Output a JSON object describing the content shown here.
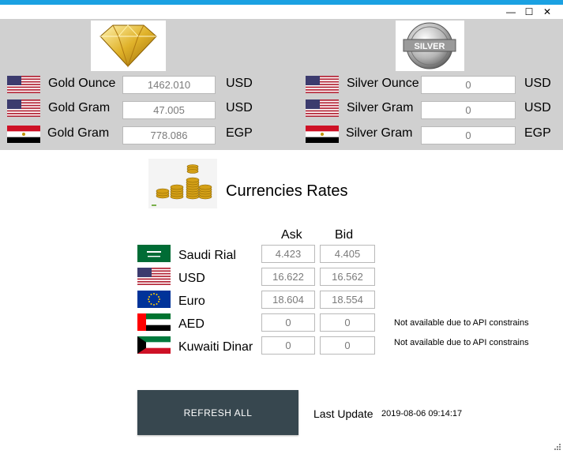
{
  "window": {
    "minimize_glyph": "—",
    "maximize_glyph": "☐",
    "close_glyph": "✕"
  },
  "gold": {
    "logo_icon": "gold-diamond-icon",
    "rows": [
      {
        "label": "Gold Ounce",
        "value": "1462.010",
        "unit": "USD",
        "flag": "usa-flag-icon"
      },
      {
        "label": "Gold Gram",
        "value": "47.005",
        "unit": "USD",
        "flag": "usa-flag-icon"
      },
      {
        "label": "Gold Gram",
        "value": "778.086",
        "unit": "EGP",
        "flag": "egypt-flag-icon"
      }
    ]
  },
  "silver": {
    "logo_text": "SILVER",
    "rows": [
      {
        "label": "Silver Ounce",
        "value": "0",
        "unit": "USD",
        "flag": "usa-flag-icon"
      },
      {
        "label": "Silver Gram",
        "value": "0",
        "unit": "USD",
        "flag": "usa-flag-icon"
      },
      {
        "label": "Silver Gram",
        "value": "0",
        "unit": "EGP",
        "flag": "egypt-flag-icon"
      }
    ]
  },
  "currencies": {
    "title": "Currencies Rates",
    "coins_icon": "gold-coins-icon",
    "ask_header": "Ask",
    "bid_header": "Bid",
    "rows": [
      {
        "name": "Saudi Rial",
        "ask": "4.423",
        "bid": "4.405",
        "note": "",
        "flag": "saudi-flag-icon"
      },
      {
        "name": "USD",
        "ask": "16.622",
        "bid": "16.562",
        "note": "",
        "flag": "usa-flag-icon"
      },
      {
        "name": "Euro",
        "ask": "18.604",
        "bid": "18.554",
        "note": "",
        "flag": "eu-flag-icon"
      },
      {
        "name": "AED",
        "ask": "0",
        "bid": "0",
        "note": "Not available due to API constrains",
        "flag": "uae-flag-icon"
      },
      {
        "name": "Kuwaiti Dinar",
        "ask": "0",
        "bid": "0",
        "note": "Not available due to API constrains",
        "flag": "kuwait-flag-icon"
      }
    ]
  },
  "footer": {
    "refresh_label": "REFRESH ALL",
    "last_update_label": "Last Update",
    "last_update_value": "2019-08-06 09:14:17"
  },
  "colors": {
    "accent": "#1ba1e2",
    "metal_panel": "#d0d0d0",
    "button": "#37474f"
  }
}
